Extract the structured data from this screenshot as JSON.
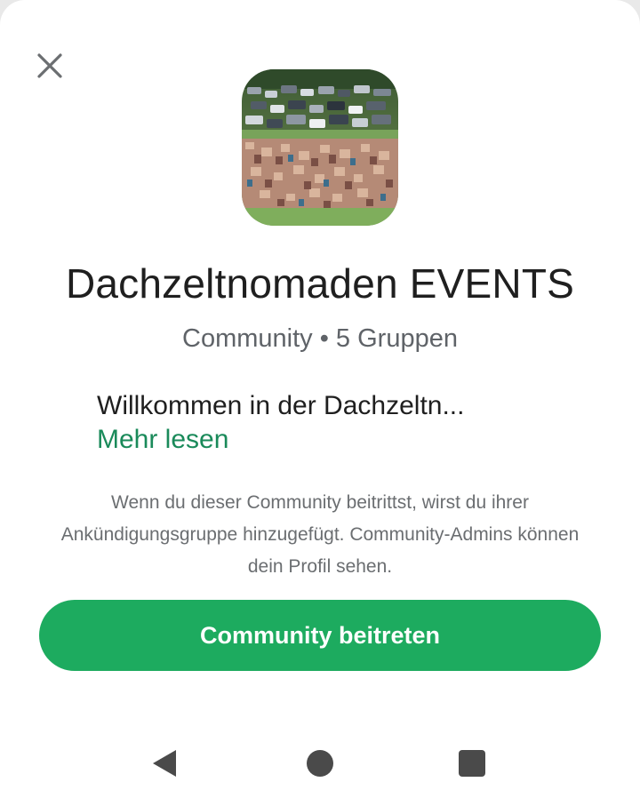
{
  "header": {
    "close_icon": "close-icon"
  },
  "community": {
    "name": "Dachzeltnomaden EVENTS",
    "meta": "Community • 5 Gruppen",
    "description": "Willkommen in der Dachzeltn...",
    "read_more_label": "Mehr lesen",
    "image_icon": "community-photo"
  },
  "info": {
    "text": "Wenn du dieser Community beitrittst, wirst du ihrer Ankündigungsgruppe hinzugefügt. Community-Admins können dein Profil sehen."
  },
  "actions": {
    "join_label": "Community beitreten"
  },
  "navbar": {
    "back_icon": "back-triangle-icon",
    "home_icon": "home-circle-icon",
    "recents_icon": "recents-square-icon"
  },
  "colors": {
    "accent": "#1dab5f",
    "link": "#1a8a5a",
    "title_text": "#1f1f1f",
    "secondary_text": "#5f6368"
  }
}
